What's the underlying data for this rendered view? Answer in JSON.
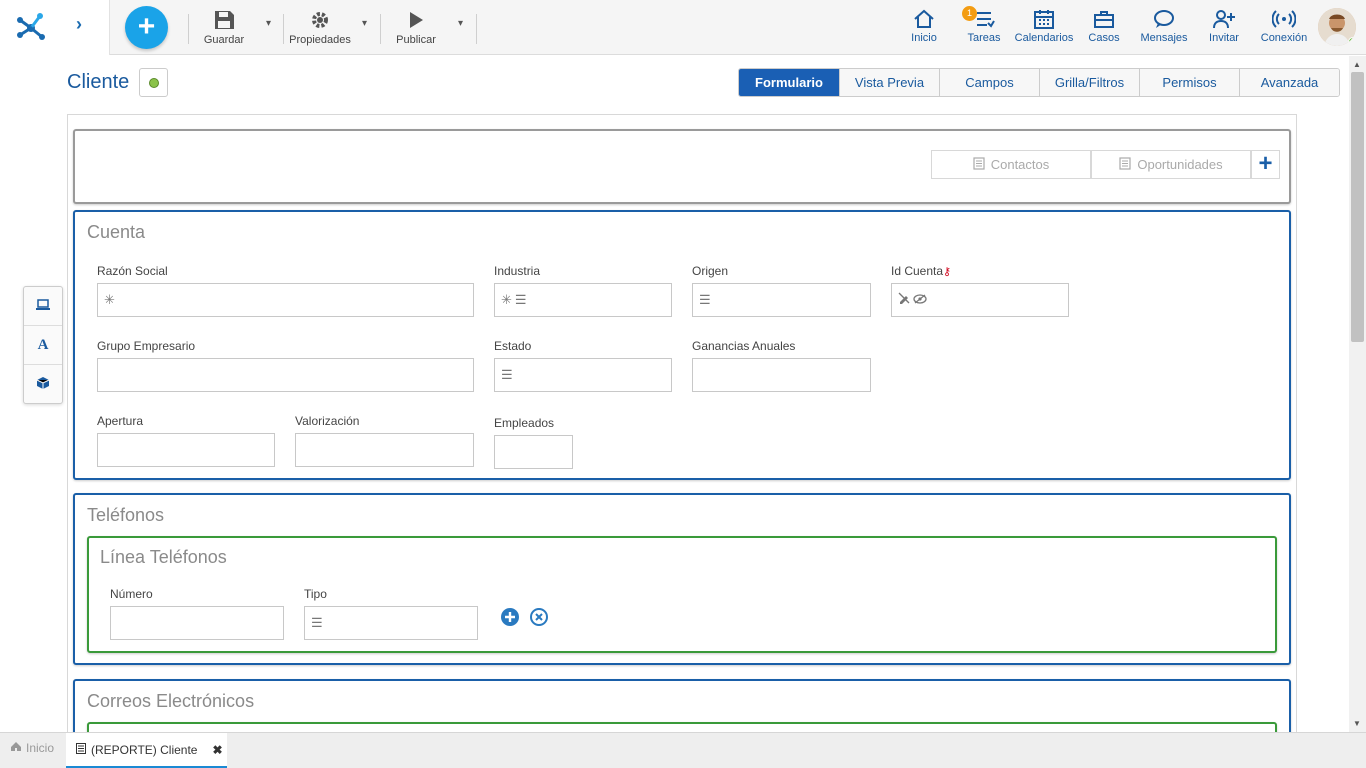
{
  "toolbar": {
    "save_label": "Guardar",
    "properties_label": "Propiedades",
    "publish_label": "Publicar"
  },
  "nav": {
    "items": [
      {
        "label": "Inicio",
        "icon": "home-icon"
      },
      {
        "label": "Tareas",
        "icon": "tasks-icon",
        "badge": "1"
      },
      {
        "label": "Calendarios",
        "icon": "calendar-icon"
      },
      {
        "label": "Casos",
        "icon": "briefcase-icon"
      },
      {
        "label": "Mensajes",
        "icon": "chat-icon"
      },
      {
        "label": "Invitar",
        "icon": "invite-user-icon"
      },
      {
        "label": "Conexión",
        "icon": "connection-icon"
      }
    ]
  },
  "page": {
    "title": "Cliente"
  },
  "tabs": [
    {
      "label": "Formulario",
      "active": true
    },
    {
      "label": "Vista Previa"
    },
    {
      "label": "Campos"
    },
    {
      "label": "Grilla/Filtros"
    },
    {
      "label": "Permisos"
    },
    {
      "label": "Avanzada"
    }
  ],
  "subtabs": {
    "contacts": "Contactos",
    "opportunities": "Oportunidades"
  },
  "sections": {
    "account": {
      "title": "Cuenta",
      "fields": {
        "razon_social": "Razón Social",
        "industria": "Industria",
        "origen": "Origen",
        "id_cuenta": "Id Cuenta",
        "grupo_empresario": "Grupo Empresario",
        "estado": "Estado",
        "ganancias_anuales": "Ganancias Anuales",
        "apertura": "Apertura",
        "valorizacion": "Valorización",
        "empleados": "Empleados"
      }
    },
    "phones": {
      "title": "Teléfonos",
      "line_title": "Línea Teléfonos",
      "fields": {
        "numero": "Número",
        "tipo": "Tipo"
      }
    },
    "emails": {
      "title": "Correos Electrónicos"
    }
  },
  "bottom_tabs": {
    "home": "Inicio",
    "active": "(REPORTE) Cliente"
  },
  "colors": {
    "accent": "#1a5fb4",
    "add_button": "#1aa3e8",
    "section_border": "#1a5fa8",
    "line_border": "#3a9a3a",
    "status_dot": "#8bc34a",
    "badge": "#f39c12"
  }
}
